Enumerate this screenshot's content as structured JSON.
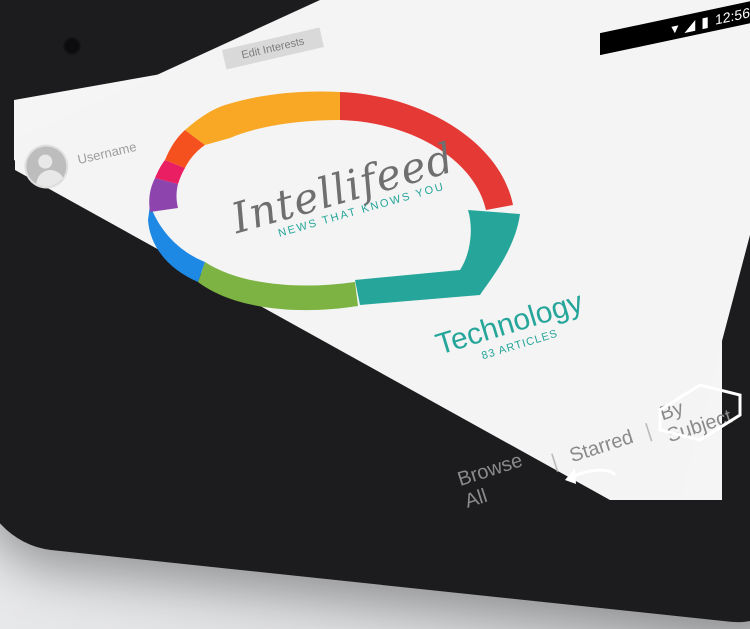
{
  "status": {
    "time": "12:56"
  },
  "header": {
    "edit_label": "Edit Interests"
  },
  "user": {
    "name": "Username"
  },
  "brand": {
    "title": "Intellifeed",
    "tagline": "NEWS THAT KNOWS YOU"
  },
  "selection": {
    "topic": "Technology",
    "count": "83 ARTICLES"
  },
  "nav": {
    "browse": "Browse All",
    "starred": "Starred",
    "subject": "By Subject",
    "sep": "|"
  },
  "ring": {
    "segments": [
      {
        "color": "#e53935"
      },
      {
        "color": "#26a69a"
      },
      {
        "color": "#7cb342"
      },
      {
        "color": "#1e88e5"
      },
      {
        "color": "#8e44ad"
      },
      {
        "color": "#e91e63"
      },
      {
        "color": "#f4511e"
      },
      {
        "color": "#f9a825"
      }
    ]
  },
  "icons": [
    "wifi-icon",
    "signal-icon",
    "battery-icon",
    "back-icon",
    "home-icon"
  ]
}
